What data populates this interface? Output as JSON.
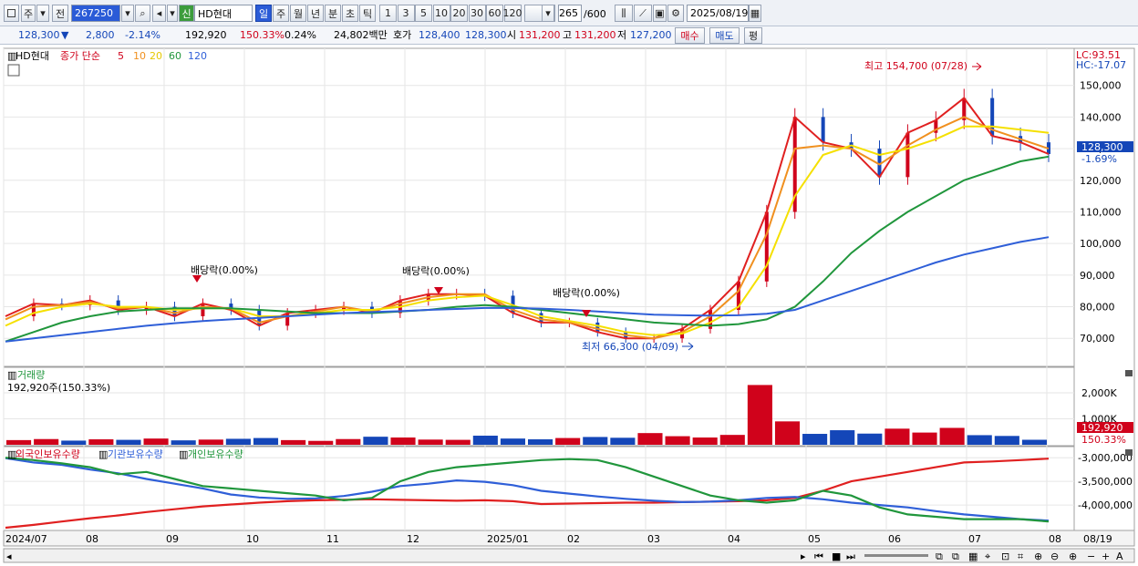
{
  "toolbar": {
    "period_label": "주",
    "prev_label": "전",
    "code_value": "267250",
    "badge_new": "신",
    "stock_name": "HD현대",
    "period_tabs": [
      "일",
      "주",
      "월",
      "년",
      "분",
      "초",
      "틱"
    ],
    "interval_buttons": [
      "1",
      "3",
      "5",
      "10",
      "20",
      "30",
      "60",
      "120"
    ],
    "count_value": "265",
    "count_total": "/600",
    "date_value": "2025/08/19"
  },
  "quote": {
    "price": "128,300",
    "down_arrow": "▼",
    "change": "2,800",
    "change_pct": "-2.14%",
    "volume": "192,920",
    "volume_ratio": "150.33%",
    "turnover": "0.24%",
    "amount": "24,802백만",
    "hoga_label": "호가",
    "hoga_bid": "128,400",
    "hoga_ask": "128,300",
    "open_label": "시",
    "open": "131,200",
    "high_label": "고",
    "high": "131,200",
    "low_label": "저",
    "low": "127,200",
    "buy_label": "매수",
    "sell_label": "매도",
    "eval_label": "평"
  },
  "legend": {
    "name": "HD현대",
    "ma_label": "종가 단순",
    "ma_periods": [
      "5",
      "10",
      "20",
      "60",
      "120"
    ]
  },
  "colors": {
    "ma5": "#e02020",
    "ma10": "#f0901f",
    "ma20": "#f5e000",
    "ma60": "#20963c",
    "ma120": "#2f5fd8",
    "up": "#d0021b",
    "down": "#1446b8",
    "foreign": "#e02020",
    "inst": "#2f5fd8",
    "indiv": "#20963c"
  },
  "price_panel": {
    "lc": "LC:93.51",
    "hc": "HC:-17.07",
    "last_price_tag": "128,300",
    "last_pct": "-1.69%",
    "annotations": [
      {
        "text": "배당락(0.00%)"
      },
      {
        "text": "배당락(0.00%)"
      },
      {
        "text": "배당락(0.00%)"
      },
      {
        "text": "최고 154,700 (07/28)"
      },
      {
        "text": "최저 66,300 (04/09)"
      }
    ]
  },
  "volume_panel": {
    "title": "거래량",
    "value": "192,920주(150.33%)",
    "last_tag": "192,920",
    "last_pct": "150.33%"
  },
  "holdings_panel": {
    "series_labels": [
      "외국인보유수량",
      "기관보유수량",
      "개인보유수량"
    ]
  },
  "x_labels": [
    "2024/07",
    "08",
    "09",
    "10",
    "11",
    "12",
    "2025/01",
    "02",
    "03",
    "04",
    "05",
    "06",
    "07",
    "08",
    "08/19"
  ],
  "chart_data": [
    {
      "type": "line",
      "title": "",
      "ylim": [
        62000,
        160000
      ],
      "y_ticks": [
        "70,000",
        "80,000",
        "90,000",
        "100,000",
        "110,000",
        "120,000",
        "130,000",
        "140,000",
        "150,000"
      ],
      "series": [
        {
          "name": "5",
          "values": [
            77000,
            81000,
            80500,
            82000,
            79000,
            80000,
            77000,
            81000,
            79000,
            74000,
            78000,
            79000,
            80000,
            78000,
            82000,
            84000,
            84000,
            83500,
            78000,
            75000,
            75000,
            72000,
            70000,
            70000,
            73000,
            79000,
            88000,
            110000,
            140000,
            132000,
            130000,
            121000,
            135000,
            139000,
            146000,
            134000,
            132000,
            128300
          ]
        },
        {
          "name": "10",
          "values": [
            76000,
            80000,
            80500,
            81500,
            79500,
            80000,
            78000,
            80000,
            79500,
            75000,
            77000,
            78500,
            80000,
            78500,
            81000,
            83000,
            84000,
            84000,
            79000,
            76000,
            75000,
            73000,
            71000,
            70000,
            72000,
            77000,
            85000,
            103000,
            130000,
            131000,
            130000,
            125000,
            131000,
            136000,
            140000,
            136000,
            133000,
            130000
          ]
        },
        {
          "name": "20",
          "values": [
            74000,
            78000,
            80000,
            81000,
            80000,
            80000,
            79000,
            79500,
            79500,
            77000,
            77000,
            78000,
            79000,
            79000,
            80000,
            82000,
            83000,
            83500,
            80500,
            77000,
            75500,
            74000,
            72000,
            71000,
            71500,
            75000,
            80000,
            93000,
            115000,
            128000,
            131000,
            128000,
            130000,
            133000,
            137000,
            137000,
            136000,
            135000
          ]
        },
        {
          "name": "60",
          "values": [
            69000,
            72000,
            75000,
            77000,
            78500,
            79000,
            79500,
            79500,
            79500,
            79000,
            78500,
            78000,
            78000,
            78000,
            78500,
            79000,
            80000,
            80500,
            80000,
            79000,
            78000,
            77000,
            76000,
            75000,
            74500,
            74000,
            74500,
            76000,
            80000,
            88000,
            97000,
            104000,
            110000,
            115000,
            120000,
            123000,
            126000,
            127500
          ]
        },
        {
          "name": "120",
          "values": [
            69000,
            70000,
            71000,
            72000,
            73000,
            74000,
            74800,
            75500,
            76000,
            76500,
            77000,
            77500,
            78000,
            78300,
            78600,
            79000,
            79300,
            79600,
            79600,
            79400,
            79000,
            78500,
            78000,
            77500,
            77300,
            77200,
            77300,
            77800,
            79000,
            82000,
            85000,
            88000,
            91000,
            94000,
            96500,
            98500,
            100500,
            102000
          ]
        }
      ]
    },
    {
      "type": "bar",
      "title": "거래량",
      "ylim": [
        0,
        2700000
      ],
      "y_ticks": [
        "1,000K",
        "2,000K"
      ],
      "values": [
        180000,
        220000,
        160000,
        210000,
        190000,
        240000,
        170000,
        200000,
        230000,
        260000,
        180000,
        150000,
        220000,
        310000,
        280000,
        200000,
        190000,
        350000,
        240000,
        210000,
        260000,
        300000,
        270000,
        450000,
        330000,
        280000,
        380000,
        2300000,
        900000,
        420000,
        560000,
        430000,
        620000,
        470000,
        650000,
        370000,
        340000,
        192920
      ]
    },
    {
      "type": "line",
      "title": "",
      "ylim": [
        -4500000,
        -2900000
      ],
      "y_ticks": [
        "-3,000,000",
        "-3,500,000",
        "-4,000,000"
      ],
      "series": [
        {
          "name": "외국인보유수량",
          "values": [
            -4480000,
            -4420000,
            -4350000,
            -4280000,
            -4220000,
            -4150000,
            -4090000,
            -4030000,
            -3990000,
            -3950000,
            -3920000,
            -3900000,
            -3890000,
            -3880000,
            -3890000,
            -3900000,
            -3910000,
            -3900000,
            -3920000,
            -3980000,
            -3970000,
            -3960000,
            -3950000,
            -3950000,
            -3940000,
            -3930000,
            -3920000,
            -3900000,
            -3850000,
            -3700000,
            -3500000,
            -3400000,
            -3300000,
            -3200000,
            -3100000,
            -3080000,
            -3050000,
            -3020000
          ]
        },
        {
          "name": "기관보유수량",
          "values": [
            -3010000,
            -3100000,
            -3150000,
            -3250000,
            -3330000,
            -3450000,
            -3550000,
            -3650000,
            -3780000,
            -3840000,
            -3870000,
            -3860000,
            -3810000,
            -3720000,
            -3600000,
            -3550000,
            -3480000,
            -3510000,
            -3580000,
            -3700000,
            -3760000,
            -3820000,
            -3870000,
            -3910000,
            -3940000,
            -3930000,
            -3900000,
            -3850000,
            -3830000,
            -3880000,
            -3950000,
            -4000000,
            -4050000,
            -4130000,
            -4200000,
            -4250000,
            -4300000,
            -4330000
          ]
        },
        {
          "name": "개인보유수량",
          "values": [
            -3000000,
            -3050000,
            -3120000,
            -3200000,
            -3350000,
            -3300000,
            -3450000,
            -3600000,
            -3650000,
            -3700000,
            -3750000,
            -3800000,
            -3900000,
            -3850000,
            -3500000,
            -3300000,
            -3200000,
            -3150000,
            -3100000,
            -3050000,
            -3030000,
            -3050000,
            -3200000,
            -3400000,
            -3600000,
            -3800000,
            -3900000,
            -3950000,
            -3900000,
            -3700000,
            -3800000,
            -4050000,
            -4200000,
            -4250000,
            -4300000,
            -4300000,
            -4300000,
            -4350000
          ]
        }
      ]
    }
  ]
}
